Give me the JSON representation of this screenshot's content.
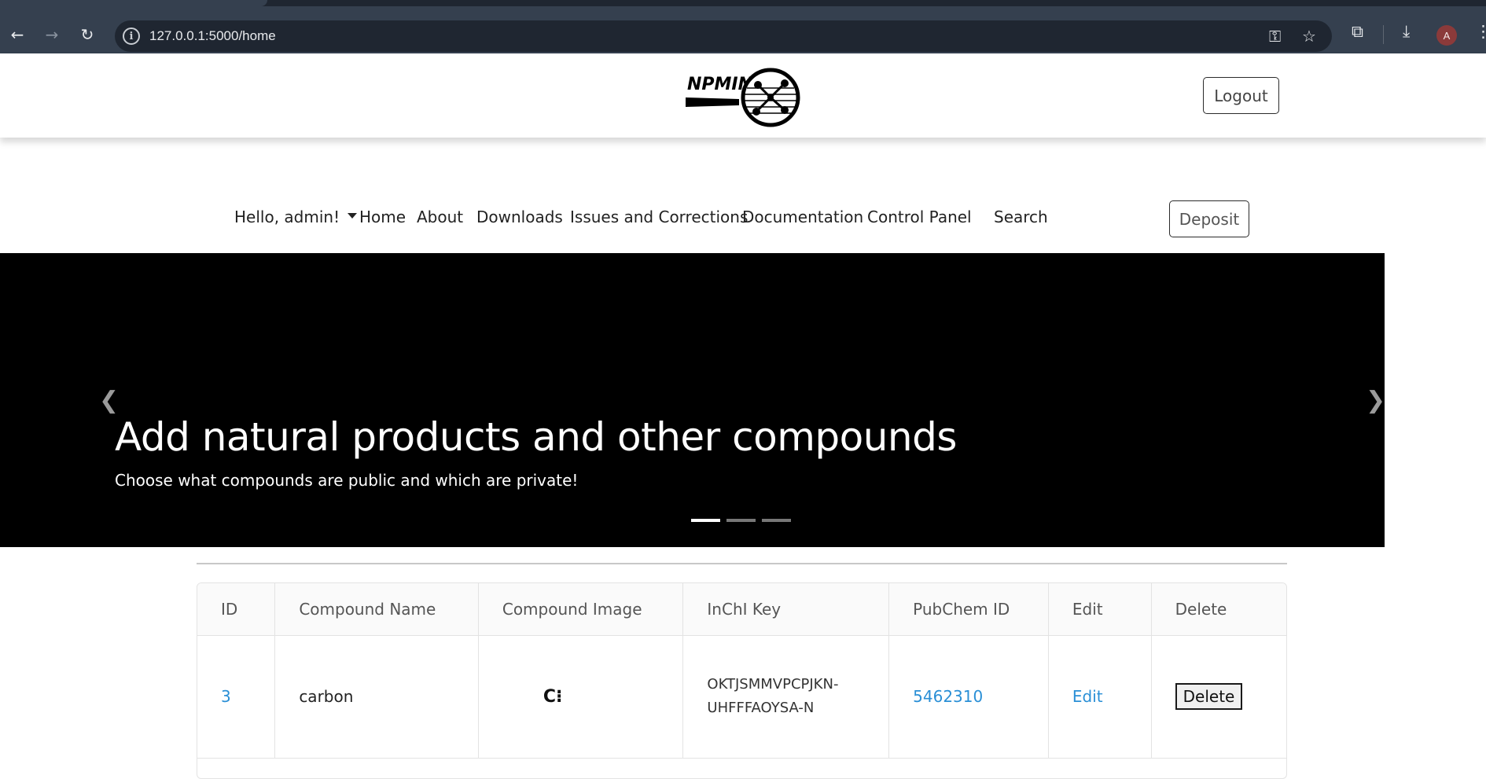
{
  "browser": {
    "url": "127.0.0.1:5000/home",
    "profile_initial": "A"
  },
  "header": {
    "logo_text": "NPMINE",
    "logout_label": "Logout"
  },
  "nav": {
    "user_menu": "Hello, admin!",
    "items": [
      "Home",
      "About",
      "Downloads",
      "Issues and Corrections",
      "Documentation",
      "Control Panel",
      "Search"
    ],
    "deposit_label": "Deposit"
  },
  "carousel": {
    "title": "Add natural products and other compounds",
    "subtitle": "Choose what compounds are public and which are private!",
    "slide_count": 3,
    "active_slide": 0
  },
  "table": {
    "headers": [
      "ID",
      "Compound Name",
      "Compound Image",
      "InChI Key",
      "PubChem ID",
      "Edit",
      "Delete"
    ],
    "rows": [
      {
        "id": "3",
        "name": "carbon",
        "image_label": "C⁝",
        "inchi_line1": "OKTJSMMVPCPJKN-",
        "inchi_line2": "UHFFFAOYSA-N",
        "pubchem_id": "5462310",
        "edit_label": "Edit",
        "delete_label": "Delete"
      }
    ]
  },
  "colors": {
    "chrome_bar": "#35404f",
    "link": "#2a8fd6",
    "carousel_bg": "#000000"
  }
}
